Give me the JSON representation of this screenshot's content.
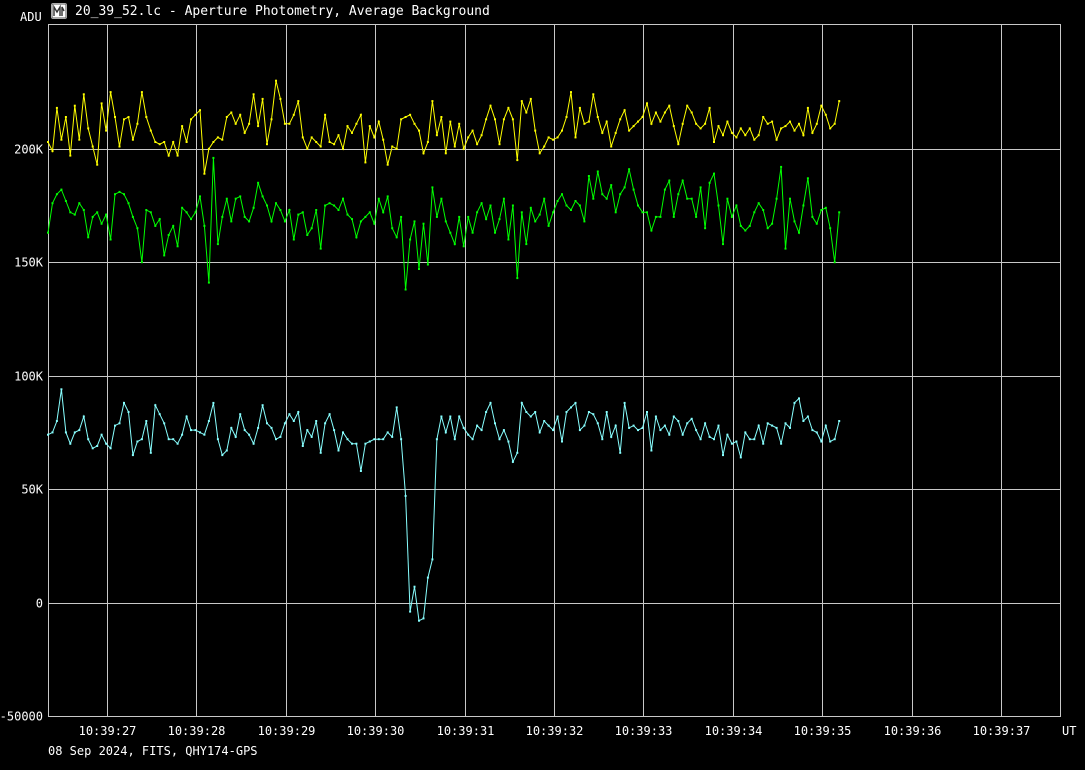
{
  "window": {
    "title": "20_39_52.lc - Aperture Photometry, Average Background"
  },
  "footer": {
    "info": "08 Sep 2024, FITS, QHY174-GPS"
  },
  "colors": {
    "background": "#000000",
    "grid": "#c8c8c8",
    "series_yellow": "#ffff00",
    "series_green": "#00ff00",
    "series_cyan": "#88ffff"
  },
  "chart_data": {
    "type": "line",
    "title": "",
    "ylabel": "ADU",
    "xlabel": "UT",
    "ylim": [
      -50000,
      255000
    ],
    "xlim": [
      26.34,
      37.66
    ],
    "y_ticks": [
      {
        "value": -50000,
        "label": "-50000"
      },
      {
        "value": 0,
        "label": "0"
      },
      {
        "value": 50000,
        "label": "50K"
      },
      {
        "value": 100000,
        "label": "100K"
      },
      {
        "value": 150000,
        "label": "150K"
      },
      {
        "value": 200000,
        "label": "200K"
      }
    ],
    "x_ticks": [
      {
        "value": 27,
        "label": "10:39:27"
      },
      {
        "value": 28,
        "label": "10:39:28"
      },
      {
        "value": 29,
        "label": "10:39:29"
      },
      {
        "value": 30,
        "label": "10:39:30"
      },
      {
        "value": 31,
        "label": "10:39:31"
      },
      {
        "value": 32,
        "label": "10:39:32"
      },
      {
        "value": 33,
        "label": "10:39:33"
      },
      {
        "value": 34,
        "label": "10:39:34"
      },
      {
        "value": 35,
        "label": "10:39:35"
      },
      {
        "value": 36,
        "label": "10:39:36"
      },
      {
        "value": 37,
        "label": "10:39:37"
      }
    ],
    "x_start": 26.34,
    "x_step": 0.05,
    "grid": true,
    "series": [
      {
        "color": "#ffff00",
        "values": [
          203000,
          199000,
          218000,
          204000,
          214000,
          197000,
          219000,
          204000,
          224000,
          209000,
          201000,
          193000,
          220000,
          208000,
          225000,
          214000,
          201000,
          213000,
          214000,
          204000,
          211000,
          225000,
          214000,
          208000,
          203000,
          202000,
          203000,
          197000,
          203000,
          197000,
          210000,
          203000,
          213000,
          215000,
          217000,
          189000,
          200000,
          203000,
          205000,
          204000,
          214000,
          216000,
          211000,
          215000,
          207000,
          211000,
          224000,
          210000,
          222000,
          202000,
          213000,
          230000,
          222000,
          211000,
          211000,
          215000,
          221000,
          205000,
          200000,
          205000,
          203000,
          201000,
          215000,
          203000,
          202000,
          206000,
          200000,
          210000,
          207000,
          211000,
          215000,
          194000,
          210000,
          205000,
          212000,
          204000,
          193000,
          201000,
          200000,
          213000,
          214000,
          215000,
          211000,
          208000,
          198000,
          203000,
          221000,
          206000,
          214000,
          198000,
          212000,
          201000,
          211000,
          200000,
          205000,
          208000,
          202000,
          206000,
          213000,
          219000,
          213000,
          202000,
          213000,
          218000,
          213000,
          195000,
          221000,
          216000,
          222000,
          208000,
          198000,
          201000,
          205000,
          204000,
          205000,
          208000,
          214000,
          225000,
          205000,
          218000,
          211000,
          212000,
          224000,
          214000,
          207000,
          212000,
          201000,
          207000,
          213000,
          217000,
          208000,
          210000,
          212000,
          214000,
          220000,
          211000,
          216000,
          212000,
          216000,
          219000,
          210000,
          202000,
          211000,
          219000,
          216000,
          211000,
          209000,
          211000,
          218000,
          203000,
          210000,
          206000,
          212000,
          207000,
          205000,
          209000,
          206000,
          209000,
          204000,
          206000,
          214000,
          211000,
          212000,
          204000,
          209000,
          210000,
          212000,
          208000,
          211000,
          206000,
          218000,
          207000,
          211000,
          219000,
          215000,
          209000,
          211000,
          221000
        ]
      },
      {
        "color": "#00ff00",
        "values": [
          163000,
          176000,
          180000,
          182000,
          177000,
          172000,
          171000,
          176000,
          173000,
          161000,
          170000,
          172000,
          167000,
          171000,
          160000,
          180000,
          181000,
          180000,
          176000,
          170000,
          165000,
          150000,
          173000,
          172000,
          166000,
          169000,
          153000,
          162000,
          166000,
          157000,
          174000,
          172000,
          169000,
          172000,
          179000,
          166000,
          141000,
          196000,
          158000,
          170000,
          178000,
          168000,
          178000,
          179000,
          170000,
          168000,
          174000,
          185000,
          179000,
          175000,
          168000,
          176000,
          173000,
          168000,
          173000,
          160000,
          171000,
          172000,
          162000,
          165000,
          173000,
          156000,
          175000,
          176000,
          175000,
          173000,
          178000,
          171000,
          169000,
          161000,
          168000,
          170000,
          172000,
          167000,
          178000,
          172000,
          179000,
          165000,
          161000,
          170000,
          138000,
          160000,
          168000,
          147000,
          167000,
          149000,
          183000,
          170000,
          178000,
          168000,
          163000,
          158000,
          170000,
          157000,
          170000,
          163000,
          172000,
          176000,
          169000,
          175000,
          163000,
          169000,
          178000,
          160000,
          175000,
          143000,
          172000,
          158000,
          174000,
          168000,
          171000,
          178000,
          166000,
          172000,
          177000,
          180000,
          175000,
          173000,
          177000,
          175000,
          168000,
          188000,
          178000,
          190000,
          180000,
          178000,
          184000,
          172000,
          180000,
          183000,
          191000,
          182000,
          175000,
          172000,
          172000,
          164000,
          170000,
          170000,
          182000,
          186000,
          170000,
          180000,
          186000,
          178000,
          178000,
          170000,
          183000,
          165000,
          185000,
          189000,
          175000,
          158000,
          178000,
          170000,
          175000,
          166000,
          164000,
          166000,
          172000,
          176000,
          173000,
          165000,
          167000,
          178000,
          192000,
          156000,
          178000,
          168000,
          163000,
          175000,
          187000,
          170000,
          167000,
          173000,
          174000,
          165000,
          150000,
          172000
        ]
      },
      {
        "color": "#88ffff",
        "values": [
          74000,
          75000,
          80000,
          94000,
          75000,
          70000,
          75000,
          76000,
          82000,
          72000,
          68000,
          69000,
          74000,
          70000,
          68000,
          78000,
          79000,
          88000,
          84000,
          65000,
          71000,
          72000,
          80000,
          66000,
          87000,
          83000,
          79000,
          72000,
          72000,
          70000,
          74000,
          82000,
          76000,
          76000,
          75000,
          74000,
          80000,
          88000,
          72000,
          65000,
          67000,
          77000,
          73000,
          83000,
          76000,
          74000,
          70000,
          77000,
          87000,
          79000,
          77000,
          72000,
          73000,
          79000,
          83000,
          80000,
          84000,
          69000,
          76000,
          73000,
          80000,
          66000,
          79000,
          83000,
          76000,
          67000,
          75000,
          72000,
          70000,
          70000,
          58000,
          70000,
          71000,
          72000,
          72000,
          72000,
          75000,
          73000,
          86000,
          72000,
          47000,
          -4000,
          7000,
          -8000,
          -7000,
          11000,
          19000,
          72000,
          82000,
          75000,
          82000,
          72000,
          82000,
          77000,
          74000,
          72000,
          78000,
          76000,
          84000,
          88000,
          79000,
          72000,
          76000,
          71000,
          62000,
          66000,
          88000,
          84000,
          82000,
          84000,
          75000,
          80000,
          78000,
          76000,
          82000,
          71000,
          84000,
          86000,
          88000,
          76000,
          78000,
          84000,
          83000,
          79000,
          72000,
          84000,
          73000,
          78000,
          66000,
          88000,
          77000,
          78000,
          76000,
          77000,
          84000,
          67000,
          82000,
          76000,
          78000,
          74000,
          82000,
          80000,
          74000,
          79000,
          81000,
          76000,
          72000,
          79000,
          73000,
          72000,
          78000,
          65000,
          74000,
          70000,
          71000,
          64000,
          75000,
          72000,
          72000,
          78000,
          70000,
          79000,
          78000,
          77000,
          70000,
          79000,
          77000,
          88000,
          90000,
          80000,
          82000,
          76000,
          75000,
          71000,
          78000,
          71000,
          72000,
          80000
        ]
      }
    ]
  }
}
